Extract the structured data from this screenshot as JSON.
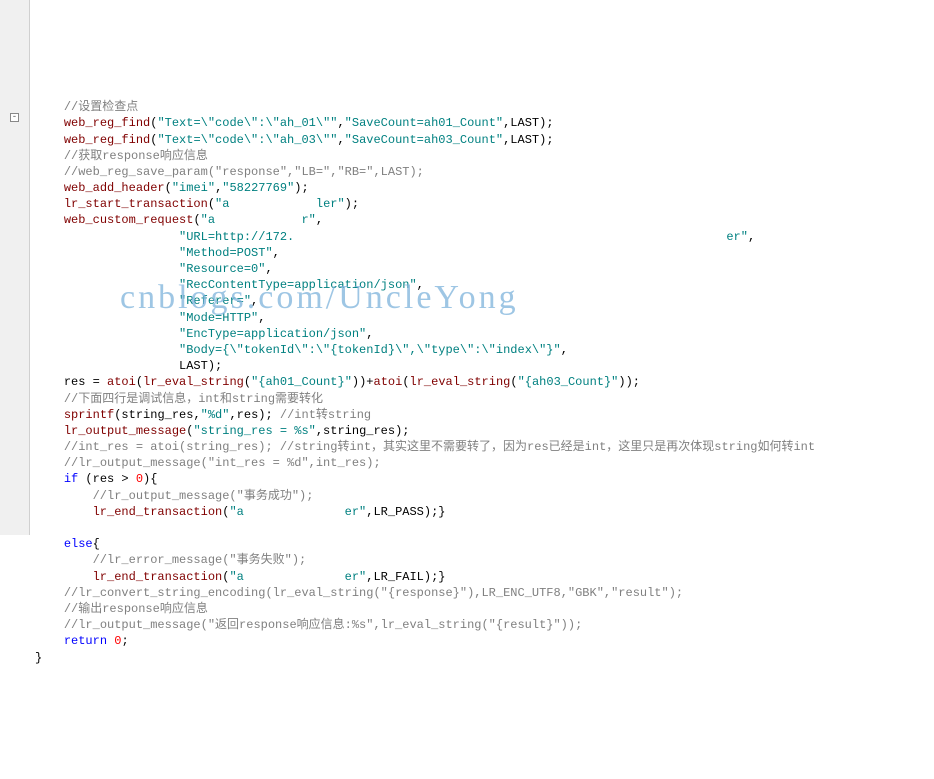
{
  "watermark": "cnblogs.com/UncleYong",
  "fold_symbol": "-",
  "lines": {
    "l1": {
      "indent": "    ",
      "segs": [
        {
          "cls": "c-comment",
          "t": "//设置检查点"
        }
      ]
    },
    "l2": {
      "indent": "    ",
      "segs": [
        {
          "cls": "c-func",
          "t": "web_reg_find"
        },
        {
          "cls": "c-plain",
          "t": "("
        },
        {
          "cls": "c-str",
          "t": "\"Text=\\\"code\\\":\\\"ah_01\\\"\""
        },
        {
          "cls": "c-plain",
          "t": ","
        },
        {
          "cls": "c-str",
          "t": "\"SaveCount=ah01_Count\""
        },
        {
          "cls": "c-plain",
          "t": ",LAST);"
        }
      ]
    },
    "l3": {
      "indent": "    ",
      "segs": [
        {
          "cls": "c-func",
          "t": "web_reg_find"
        },
        {
          "cls": "c-plain",
          "t": "("
        },
        {
          "cls": "c-str",
          "t": "\"Text=\\\"code\\\":\\\"ah_03\\\"\""
        },
        {
          "cls": "c-plain",
          "t": ","
        },
        {
          "cls": "c-str",
          "t": "\"SaveCount=ah03_Count\""
        },
        {
          "cls": "c-plain",
          "t": ",LAST);"
        }
      ]
    },
    "l4": {
      "indent": "    ",
      "segs": [
        {
          "cls": "c-comment",
          "t": "//获取response响应信息"
        }
      ]
    },
    "l5": {
      "indent": "    ",
      "segs": [
        {
          "cls": "c-comment",
          "t": "//web_reg_save_param(\"response\",\"LB=\",\"RB=\",LAST);"
        }
      ]
    },
    "l6": {
      "indent": "    ",
      "segs": [
        {
          "cls": "c-func",
          "t": "web_add_header"
        },
        {
          "cls": "c-plain",
          "t": "("
        },
        {
          "cls": "c-str",
          "t": "\"imei\""
        },
        {
          "cls": "c-plain",
          "t": ","
        },
        {
          "cls": "c-str",
          "t": "\"58227769\""
        },
        {
          "cls": "c-plain",
          "t": ");"
        }
      ]
    },
    "l7": {
      "indent": "    ",
      "segs": [
        {
          "cls": "c-func",
          "t": "lr_start_transaction"
        },
        {
          "cls": "c-plain",
          "t": "("
        },
        {
          "cls": "c-str",
          "t": "\"a            ler\""
        },
        {
          "cls": "c-plain",
          "t": ");"
        }
      ]
    },
    "l8": {
      "indent": "    ",
      "segs": [
        {
          "cls": "c-func",
          "t": "web_custom_request"
        },
        {
          "cls": "c-plain",
          "t": "("
        },
        {
          "cls": "c-str",
          "t": "\"a            r\""
        },
        {
          "cls": "c-plain",
          "t": ","
        }
      ]
    },
    "l9": {
      "indent": "                    ",
      "segs": [
        {
          "cls": "c-str",
          "t": "\"URL=http://172.                                                            er\""
        },
        {
          "cls": "c-plain",
          "t": ","
        }
      ]
    },
    "l10": {
      "indent": "                    ",
      "segs": [
        {
          "cls": "c-str",
          "t": "\"Method=POST\""
        },
        {
          "cls": "c-plain",
          "t": ","
        }
      ]
    },
    "l11": {
      "indent": "                    ",
      "segs": [
        {
          "cls": "c-str",
          "t": "\"Resource=0\""
        },
        {
          "cls": "c-plain",
          "t": ","
        }
      ]
    },
    "l12": {
      "indent": "                    ",
      "segs": [
        {
          "cls": "c-str",
          "t": "\"RecContentType=application/json\""
        },
        {
          "cls": "c-plain",
          "t": ","
        }
      ]
    },
    "l13": {
      "indent": "                    ",
      "segs": [
        {
          "cls": "c-str",
          "t": "\"Referer=\""
        },
        {
          "cls": "c-plain",
          "t": ","
        }
      ]
    },
    "l14": {
      "indent": "                    ",
      "segs": [
        {
          "cls": "c-str",
          "t": "\"Mode=HTTP\""
        },
        {
          "cls": "c-plain",
          "t": ","
        }
      ]
    },
    "l15": {
      "indent": "                    ",
      "segs": [
        {
          "cls": "c-str",
          "t": "\"EncType=application/json\""
        },
        {
          "cls": "c-plain",
          "t": ","
        }
      ]
    },
    "l16": {
      "indent": "                    ",
      "segs": [
        {
          "cls": "c-str",
          "t": "\"Body={\\\"tokenId\\\":\\\"{tokenId}\\\",\\\"type\\\":\\\"index\\\"}\""
        },
        {
          "cls": "c-plain",
          "t": ","
        }
      ]
    },
    "l17": {
      "indent": "                    ",
      "segs": [
        {
          "cls": "c-plain",
          "t": "LAST);"
        }
      ]
    },
    "l18": {
      "indent": "    ",
      "segs": [
        {
          "cls": "c-plain",
          "t": "res = "
        },
        {
          "cls": "c-func",
          "t": "atoi"
        },
        {
          "cls": "c-plain",
          "t": "("
        },
        {
          "cls": "c-func",
          "t": "lr_eval_string"
        },
        {
          "cls": "c-plain",
          "t": "("
        },
        {
          "cls": "c-str",
          "t": "\"{ah01_Count}\""
        },
        {
          "cls": "c-plain",
          "t": "))+"
        },
        {
          "cls": "c-func",
          "t": "atoi"
        },
        {
          "cls": "c-plain",
          "t": "("
        },
        {
          "cls": "c-func",
          "t": "lr_eval_string"
        },
        {
          "cls": "c-plain",
          "t": "("
        },
        {
          "cls": "c-str",
          "t": "\"{ah03_Count}\""
        },
        {
          "cls": "c-plain",
          "t": "));"
        }
      ]
    },
    "l19": {
      "indent": "    ",
      "segs": [
        {
          "cls": "c-comment",
          "t": "//下面四行是调试信息，int和string需要转化"
        }
      ]
    },
    "l20": {
      "indent": "    ",
      "segs": [
        {
          "cls": "c-func",
          "t": "sprintf"
        },
        {
          "cls": "c-plain",
          "t": "(string_res,"
        },
        {
          "cls": "c-str",
          "t": "\"%d\""
        },
        {
          "cls": "c-plain",
          "t": ",res); "
        },
        {
          "cls": "c-comment",
          "t": "//int转string"
        }
      ]
    },
    "l21": {
      "indent": "    ",
      "segs": [
        {
          "cls": "c-func",
          "t": "lr_output_message"
        },
        {
          "cls": "c-plain",
          "t": "("
        },
        {
          "cls": "c-str",
          "t": "\"string_res = %s\""
        },
        {
          "cls": "c-plain",
          "t": ",string_res);"
        }
      ]
    },
    "l22": {
      "indent": "    ",
      "segs": [
        {
          "cls": "c-comment",
          "t": "//int_res = atoi(string_res); //string转int，其实这里不需要转了，因为res已经是int，这里只是再次体现string如何转int"
        }
      ]
    },
    "l23": {
      "indent": "    ",
      "segs": [
        {
          "cls": "c-comment",
          "t": "//lr_output_message(\"int_res = %d\",int_res);"
        }
      ]
    },
    "l24": {
      "indent": "    ",
      "segs": [
        {
          "cls": "c-keyword",
          "t": "if"
        },
        {
          "cls": "c-plain",
          "t": " (res > "
        },
        {
          "cls": "c-num",
          "t": "0"
        },
        {
          "cls": "c-plain",
          "t": "){"
        }
      ]
    },
    "l25": {
      "indent": "        ",
      "segs": [
        {
          "cls": "c-comment",
          "t": "//lr_output_message(\"事务成功\");"
        }
      ]
    },
    "l26": {
      "indent": "        ",
      "segs": [
        {
          "cls": "c-func",
          "t": "lr_end_transaction"
        },
        {
          "cls": "c-plain",
          "t": "("
        },
        {
          "cls": "c-str",
          "t": "\"a              er\""
        },
        {
          "cls": "c-plain",
          "t": ",LR_PASS);}"
        }
      ]
    },
    "l27": {
      "indent": "",
      "segs": [
        {
          "cls": "c-plain",
          "t": " "
        }
      ]
    },
    "l28": {
      "indent": "    ",
      "segs": [
        {
          "cls": "c-keyword",
          "t": "else"
        },
        {
          "cls": "c-plain",
          "t": "{"
        }
      ]
    },
    "l29": {
      "indent": "        ",
      "segs": [
        {
          "cls": "c-comment",
          "t": "//lr_error_message(\"事务失败\");"
        }
      ]
    },
    "l30": {
      "indent": "        ",
      "segs": [
        {
          "cls": "c-func",
          "t": "lr_end_transaction"
        },
        {
          "cls": "c-plain",
          "t": "("
        },
        {
          "cls": "c-str",
          "t": "\"a              er\""
        },
        {
          "cls": "c-plain",
          "t": ",LR_FAIL);}"
        }
      ]
    },
    "l31": {
      "indent": "    ",
      "segs": [
        {
          "cls": "c-comment",
          "t": "//lr_convert_string_encoding(lr_eval_string(\"{response}\"),LR_ENC_UTF8,\"GBK\",\"result\");"
        }
      ]
    },
    "l32": {
      "indent": "    ",
      "segs": [
        {
          "cls": "c-comment",
          "t": "//输出response响应信息"
        }
      ]
    },
    "l33": {
      "indent": "    ",
      "segs": [
        {
          "cls": "c-comment",
          "t": "//lr_output_message(\"返回response响应信息:%s\",lr_eval_string(\"{result}\"));"
        }
      ]
    },
    "l34": {
      "indent": "    ",
      "segs": [
        {
          "cls": "c-keyword",
          "t": "return"
        },
        {
          "cls": "c-plain",
          "t": " "
        },
        {
          "cls": "c-num",
          "t": "0"
        },
        {
          "cls": "c-plain",
          "t": ";"
        }
      ]
    },
    "l35": {
      "indent": "",
      "segs": [
        {
          "cls": "c-plain",
          "t": "}"
        }
      ]
    }
  },
  "line_order": [
    "l1",
    "l2",
    "l3",
    "l4",
    "l5",
    "l6",
    "l7",
    "l8",
    "l9",
    "l10",
    "l11",
    "l12",
    "l13",
    "l14",
    "l15",
    "l16",
    "l17",
    "l18",
    "l19",
    "l20",
    "l21",
    "l22",
    "l23",
    "l24",
    "l25",
    "l26",
    "l27",
    "l28",
    "l29",
    "l30",
    "l31",
    "l32",
    "l33",
    "l34",
    "l35"
  ]
}
